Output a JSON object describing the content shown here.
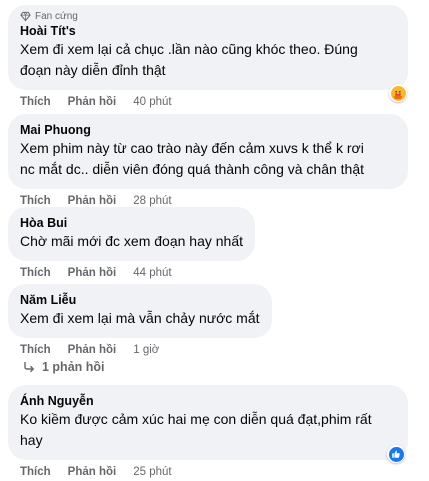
{
  "actions": {
    "like": "Thích",
    "reply": "Phản hồi"
  },
  "comments": [
    {
      "badge": "Fan cứng",
      "author": "Hoài Tít's",
      "text_lines": [
        "Xem đi xem lại cả chục .lần nào cũng khóc theo. Đúng",
        "đoạn này diễn đỉnh thật"
      ],
      "time": "40 phút",
      "reaction": "care"
    },
    {
      "author": "Mai Phuong",
      "text_lines": [
        "Xem phim này từ cao trào này đến cảm xuvs k thể k rơi",
        "nc mắt dc.. diễn viên đóng quá thành công và chân thật"
      ],
      "time": "28 phút"
    },
    {
      "author": "Hòa Bui",
      "text_lines": [
        "Chờ mãi mới đc xem đoạn hay nhất"
      ],
      "time": "44 phút"
    },
    {
      "author": "Năm Liễu",
      "text_lines": [
        "Xem đi xem lại mà vẫn chảy nước mắt"
      ],
      "time": "1 giờ"
    },
    {
      "author": "Ánh Nguyễn",
      "text_lines": [
        "Ko kiềm được cảm xúc hai mẹ con diễn quá đạt,phim rất",
        "hay"
      ],
      "time": "25 phút",
      "reaction": "like"
    }
  ],
  "replies_link": "1 phản hồi",
  "colors": {
    "bubble": "#f0f2f5",
    "meta": "#65676b",
    "like_blue": "#1877f2",
    "care_yellow": "#f7b928"
  }
}
